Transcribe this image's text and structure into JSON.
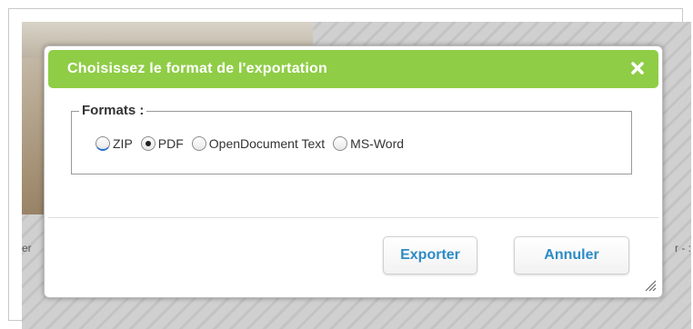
{
  "dialog": {
    "title": "Choisissez le format de l'exportation",
    "close_icon": "close-icon",
    "formats_legend": "Formats :",
    "options": [
      {
        "label": "ZIP",
        "checked": false
      },
      {
        "label": "PDF",
        "checked": true
      },
      {
        "label": "OpenDocument Text",
        "checked": false
      },
      {
        "label": "MS-Word",
        "checked": false
      }
    ],
    "export_label": "Exporter",
    "cancel_label": "Annuler"
  },
  "background": {
    "left_text": "er",
    "right_text": "r - :"
  },
  "colors": {
    "titlebar": "#8fcd46",
    "button_text": "#2e8bc5"
  }
}
